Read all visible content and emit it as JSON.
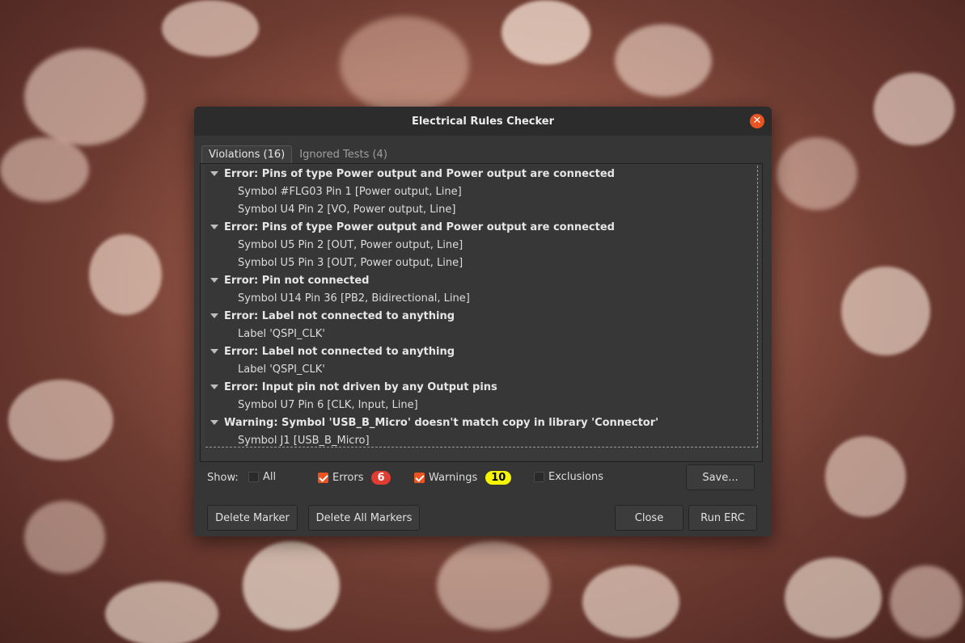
{
  "dialog": {
    "title": "Electrical Rules Checker",
    "close_icon": "close-icon"
  },
  "tabs": [
    {
      "label": "Violations (16)",
      "active": true
    },
    {
      "label": "Ignored Tests (4)",
      "active": false
    }
  ],
  "violations": [
    {
      "header": "Error: Pins of type Power output and Power output are connected",
      "items": [
        "Symbol #FLG03 Pin 1 [Power output, Line]",
        "Symbol U4 Pin 2 [VO, Power output, Line]"
      ]
    },
    {
      "header": "Error: Pins of type Power output and Power output are connected",
      "items": [
        "Symbol U5 Pin 2 [OUT, Power output, Line]",
        "Symbol U5 Pin 3 [OUT, Power output, Line]"
      ]
    },
    {
      "header": "Error: Pin not connected",
      "items": [
        "Symbol U14 Pin 36 [PB2, Bidirectional, Line]"
      ]
    },
    {
      "header": "Error: Label not connected to anything",
      "items": [
        "Label 'QSPI_CLK'"
      ]
    },
    {
      "header": "Error: Label not connected to anything",
      "items": [
        "Label 'QSPI_CLK'"
      ]
    },
    {
      "header": "Error: Input pin not driven by any Output pins",
      "items": [
        "Symbol U7 Pin 6 [CLK, Input, Line]"
      ]
    },
    {
      "header": "Warning: Symbol 'USB_B_Micro' doesn't match copy in library 'Connector'",
      "items": [
        "Symbol J1 [USB_B_Micro]"
      ]
    }
  ],
  "filters": {
    "show_label": "Show:",
    "all": {
      "label": "All",
      "checked": false
    },
    "errors": {
      "label": "Errors",
      "checked": true,
      "count": "6"
    },
    "warnings": {
      "label": "Warnings",
      "checked": true,
      "count": "10"
    },
    "exclusions": {
      "label": "Exclusions",
      "checked": false
    }
  },
  "buttons": {
    "save": "Save...",
    "delete_marker": "Delete Marker",
    "delete_all_markers": "Delete All Markers",
    "close": "Close",
    "run_erc": "Run ERC"
  },
  "colors": {
    "accent": "#e95420",
    "error_badge": "#e03c31",
    "warning_badge": "#f5f500"
  }
}
